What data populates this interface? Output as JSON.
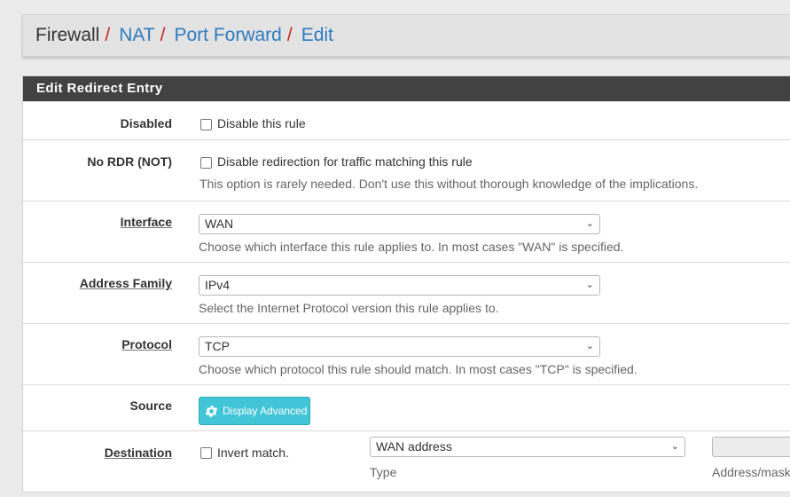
{
  "breadcrumb": {
    "items": [
      "Firewall",
      "NAT",
      "Port Forward",
      "Edit"
    ],
    "separator": "/"
  },
  "panel": {
    "title": "Edit Redirect Entry"
  },
  "rows": {
    "disabled": {
      "label": "Disabled",
      "checkbox_label": "Disable this rule",
      "checked": false
    },
    "nordr": {
      "label": "No RDR (NOT)",
      "checkbox_label": "Disable redirection for traffic matching this rule",
      "help": "This option is rarely needed. Don't use this without thorough knowledge of the implications.",
      "checked": false
    },
    "interface": {
      "label": "Interface",
      "value": "WAN",
      "help": "Choose which interface this rule applies to. In most cases \"WAN\" is specified."
    },
    "family": {
      "label": "Address Family",
      "value": "IPv4",
      "help": "Select the Internet Protocol version this rule applies to."
    },
    "protocol": {
      "label": "Protocol",
      "value": "TCP",
      "help": "Choose which protocol this rule should match. In most cases \"TCP\" is specified."
    },
    "source": {
      "label": "Source",
      "button_label": "Display Advanced",
      "button_icon": "gear-icon"
    },
    "destination": {
      "label": "Destination",
      "invert_label": "Invert match.",
      "type_value": "WAN address",
      "type_caption": "Type",
      "addr_caption": "Address/mask",
      "checked": false
    }
  },
  "colors": {
    "accent": "#2f7bbf",
    "separator": "#c4271f",
    "heading_bg": "#424242",
    "button": "#43c5d8"
  }
}
